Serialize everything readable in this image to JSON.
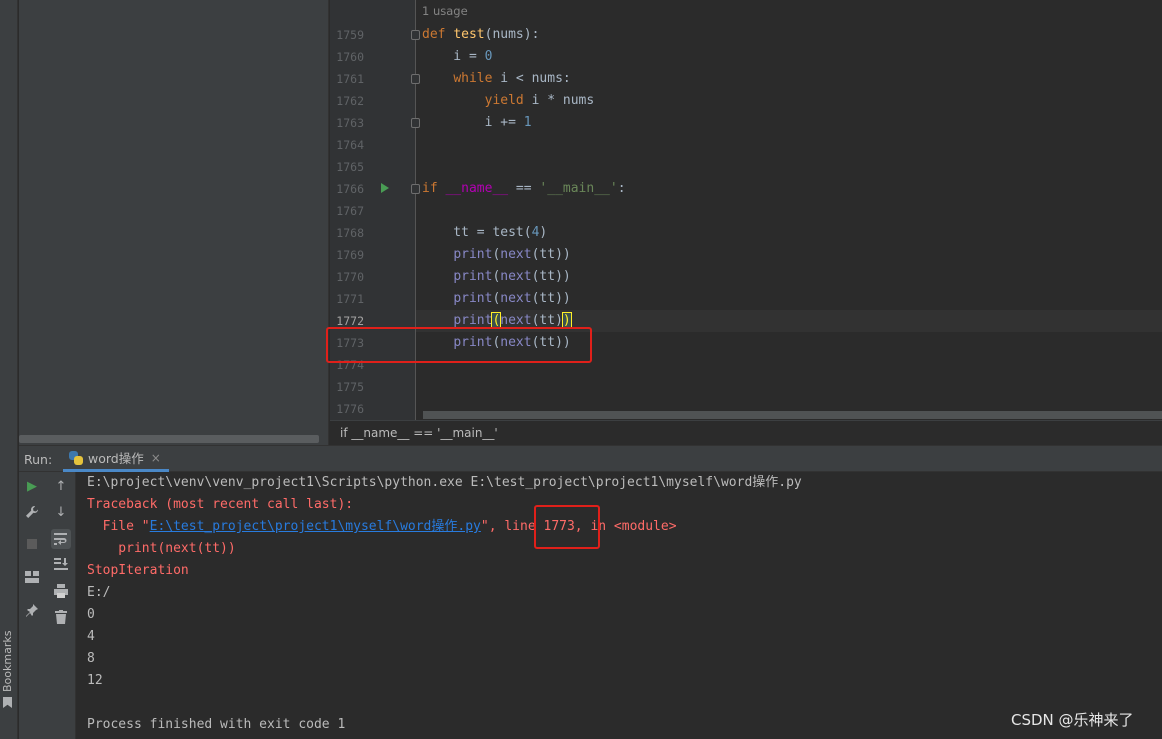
{
  "editor": {
    "usage_hint": "1 usage",
    "lines": [
      {
        "num": "1759",
        "segments": [
          {
            "t": "def ",
            "c": "kw"
          },
          {
            "t": "test",
            "c": "fn"
          },
          {
            "t": "(nums):",
            "c": ""
          }
        ]
      },
      {
        "num": "1760",
        "segments": [
          {
            "t": "    i = ",
            "c": ""
          },
          {
            "t": "0",
            "c": "num"
          }
        ]
      },
      {
        "num": "1761",
        "segments": [
          {
            "t": "    ",
            "c": ""
          },
          {
            "t": "while",
            "c": "kw"
          },
          {
            "t": " i < nums:",
            "c": ""
          }
        ]
      },
      {
        "num": "1762",
        "segments": [
          {
            "t": "        ",
            "c": ""
          },
          {
            "t": "yield",
            "c": "kw"
          },
          {
            "t": " i * nums",
            "c": ""
          }
        ]
      },
      {
        "num": "1763",
        "segments": [
          {
            "t": "        i += ",
            "c": ""
          },
          {
            "t": "1",
            "c": "num"
          }
        ]
      },
      {
        "num": "1764",
        "segments": []
      },
      {
        "num": "1765",
        "segments": []
      },
      {
        "num": "1766",
        "segments": [
          {
            "t": "if",
            "c": "kw"
          },
          {
            "t": " ",
            "c": ""
          },
          {
            "t": "__name__",
            "c": "magic"
          },
          {
            "t": " == ",
            "c": ""
          },
          {
            "t": "'__main__'",
            "c": "str"
          },
          {
            "t": ":",
            "c": ""
          }
        ]
      },
      {
        "num": "1767",
        "segments": []
      },
      {
        "num": "1768",
        "segments": [
          {
            "t": "    tt = test(",
            "c": ""
          },
          {
            "t": "4",
            "c": "num"
          },
          {
            "t": ")",
            "c": ""
          }
        ]
      },
      {
        "num": "1769",
        "segments": [
          {
            "t": "    ",
            "c": ""
          },
          {
            "t": "print",
            "c": "bi"
          },
          {
            "t": "(",
            "c": ""
          },
          {
            "t": "next",
            "c": "bi"
          },
          {
            "t": "(tt))",
            "c": ""
          }
        ]
      },
      {
        "num": "1770",
        "segments": [
          {
            "t": "    ",
            "c": ""
          },
          {
            "t": "print",
            "c": "bi"
          },
          {
            "t": "(",
            "c": ""
          },
          {
            "t": "next",
            "c": "bi"
          },
          {
            "t": "(tt))",
            "c": ""
          }
        ]
      },
      {
        "num": "1771",
        "segments": [
          {
            "t": "    ",
            "c": ""
          },
          {
            "t": "print",
            "c": "bi"
          },
          {
            "t": "(",
            "c": ""
          },
          {
            "t": "next",
            "c": "bi"
          },
          {
            "t": "(tt))",
            "c": ""
          }
        ]
      },
      {
        "num": "1772",
        "segments": [
          {
            "t": "    ",
            "c": ""
          },
          {
            "t": "print",
            "c": "bi"
          },
          {
            "t": "(",
            "c": "match"
          },
          {
            "t": "next",
            "c": "bi"
          },
          {
            "t": "(tt)",
            "c": ""
          },
          {
            "t": ")",
            "c": "match"
          }
        ]
      },
      {
        "num": "1773",
        "segments": [
          {
            "t": "    ",
            "c": ""
          },
          {
            "t": "print",
            "c": "bi"
          },
          {
            "t": "(",
            "c": ""
          },
          {
            "t": "next",
            "c": "bi"
          },
          {
            "t": "(tt))",
            "c": ""
          }
        ]
      },
      {
        "num": "1774",
        "segments": []
      },
      {
        "num": "1775",
        "segments": []
      },
      {
        "num": "1776",
        "segments": []
      }
    ],
    "current_line": "1772"
  },
  "breadcrumb": "if __name__ == '__main__'",
  "run": {
    "label": "Run:",
    "tab_name": "word操作",
    "tab_close": "×",
    "console": [
      {
        "segments": [
          {
            "t": "E:\\project\\venv\\venv_project1\\Scripts\\python.exe E:\\test_project\\project1\\myself\\word操作.py",
            "c": ""
          }
        ]
      },
      {
        "segments": [
          {
            "t": "Traceback (most recent call last):",
            "c": "err"
          }
        ]
      },
      {
        "segments": [
          {
            "t": "  File \"",
            "c": "err"
          },
          {
            "t": "E:\\test_project\\project1\\myself\\word操作.py",
            "c": "link"
          },
          {
            "t": "\", line 1773, in <module>",
            "c": "err"
          }
        ]
      },
      {
        "segments": [
          {
            "t": "    print(next(tt))",
            "c": "err"
          }
        ]
      },
      {
        "segments": [
          {
            "t": "StopIteration",
            "c": "err"
          }
        ]
      },
      {
        "segments": [
          {
            "t": "E:/",
            "c": ""
          }
        ]
      },
      {
        "segments": [
          {
            "t": "0",
            "c": ""
          }
        ]
      },
      {
        "segments": [
          {
            "t": "4",
            "c": ""
          }
        ]
      },
      {
        "segments": [
          {
            "t": "8",
            "c": ""
          }
        ]
      },
      {
        "segments": [
          {
            "t": "12",
            "c": ""
          }
        ]
      },
      {
        "segments": []
      },
      {
        "segments": [
          {
            "t": "Process finished with exit code 1",
            "c": ""
          }
        ]
      }
    ]
  },
  "sidebar": {
    "bookmarks_label": "Bookmarks"
  },
  "watermark": "CSDN @乐神来了",
  "colors": {
    "highlight_box": "#e0201a",
    "error_text": "#ff6b68",
    "link": "#287bde"
  }
}
